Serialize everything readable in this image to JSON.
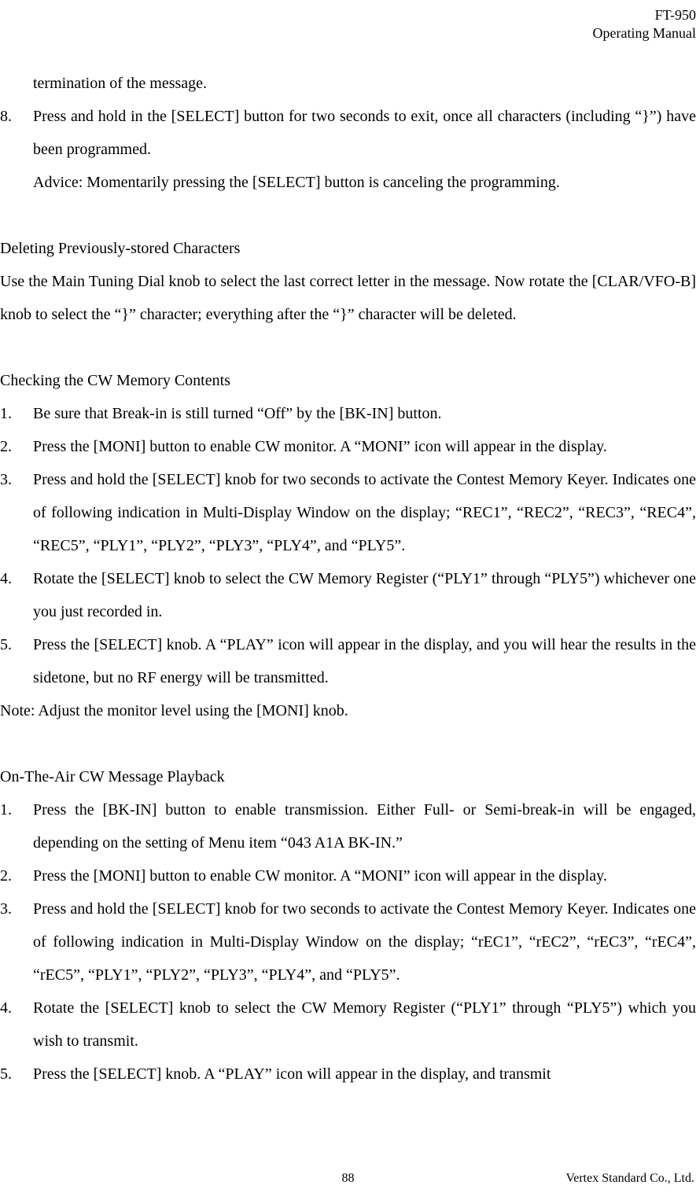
{
  "header": {
    "model": "FT-950",
    "title": "Operating Manual"
  },
  "content": {
    "line1": "termination of the message.",
    "item8_num": "8.",
    "item8_text": "Press and hold in the [SELECT] button for two seconds to exit, once all characters (including “}”) have been programmed.",
    "item8_advice": "Advice: Momentarily pressing the [SELECT] button is canceling the programming.",
    "section1_title": "Deleting Previously-stored Characters",
    "section1_text": "Use the Main Tuning Dial knob to select the last correct letter in the message. Now rotate the [CLAR/VFO-B] knob to select the “}” character; everything after the “}” character will be deleted.",
    "section2_title": "Checking the CW Memory Contents",
    "s2_item1_num": "1.",
    "s2_item1_text": "Be sure that Break-in is still turned “Off” by the [BK-IN] button.",
    "s2_item2_num": "2.",
    "s2_item2_text": "Press the [MONI] button to enable CW monitor. A “MONI” icon will appear in the display.",
    "s2_item3_num": "3.",
    "s2_item3_text": "Press and hold the [SELECT] knob for two seconds to activate the Contest Memory Keyer. Indicates one of following indication in Multi-Display Window on the display; “REC1”, “REC2”, “REC3”, “REC4”, “REC5”, “PLY1”, “PLY2”, “PLY3”, “PLY4”, and “PLY5”.",
    "s2_item4_num": "4.",
    "s2_item4_text": "Rotate the [SELECT] knob to select the CW Memory Register (“PLY1” through “PLY5”) whichever one you just recorded in.",
    "s2_item5_num": "5.",
    "s2_item5_text": "Press the [SELECT] knob. A “PLAY” icon will appear in the display, and you will hear the results in the sidetone, but no RF energy will be transmitted.",
    "s2_note": "Note: Adjust the monitor level using the [MONI] knob.",
    "section3_title": "On-The-Air CW Message Playback",
    "s3_item1_num": "1.",
    "s3_item1_text": "Press the [BK-IN] button to enable transmission. Either Full- or Semi-break-in will be engaged, depending on the setting of Menu item “043 A1A BK-IN.”",
    "s3_item2_num": "2.",
    "s3_item2_text": "Press the [MONI] button to enable CW monitor. A “MONI” icon will appear in the display.",
    "s3_item3_num": "3.",
    "s3_item3_text": "Press and hold the [SELECT] knob for two seconds to activate the Contest Memory Keyer. Indicates one of following indication in Multi-Display Window on the display; “rEC1”, “rEC2”, “rEC3”, “rEC4”, “rEC5”, “PLY1”, “PLY2”, “PLY3”, “PLY4”, and “PLY5”.",
    "s3_item4_num": "4.",
    "s3_item4_text": "Rotate the [SELECT] knob to select the CW Memory Register (“PLY1” through “PLY5”) which you wish to transmit.",
    "s3_item5_num": "5.",
    "s3_item5_text": "Press the [SELECT] knob. A “PLAY” icon will appear in the display, and transmit"
  },
  "footer": {
    "page": "88",
    "company": "Vertex Standard Co., Ltd."
  }
}
